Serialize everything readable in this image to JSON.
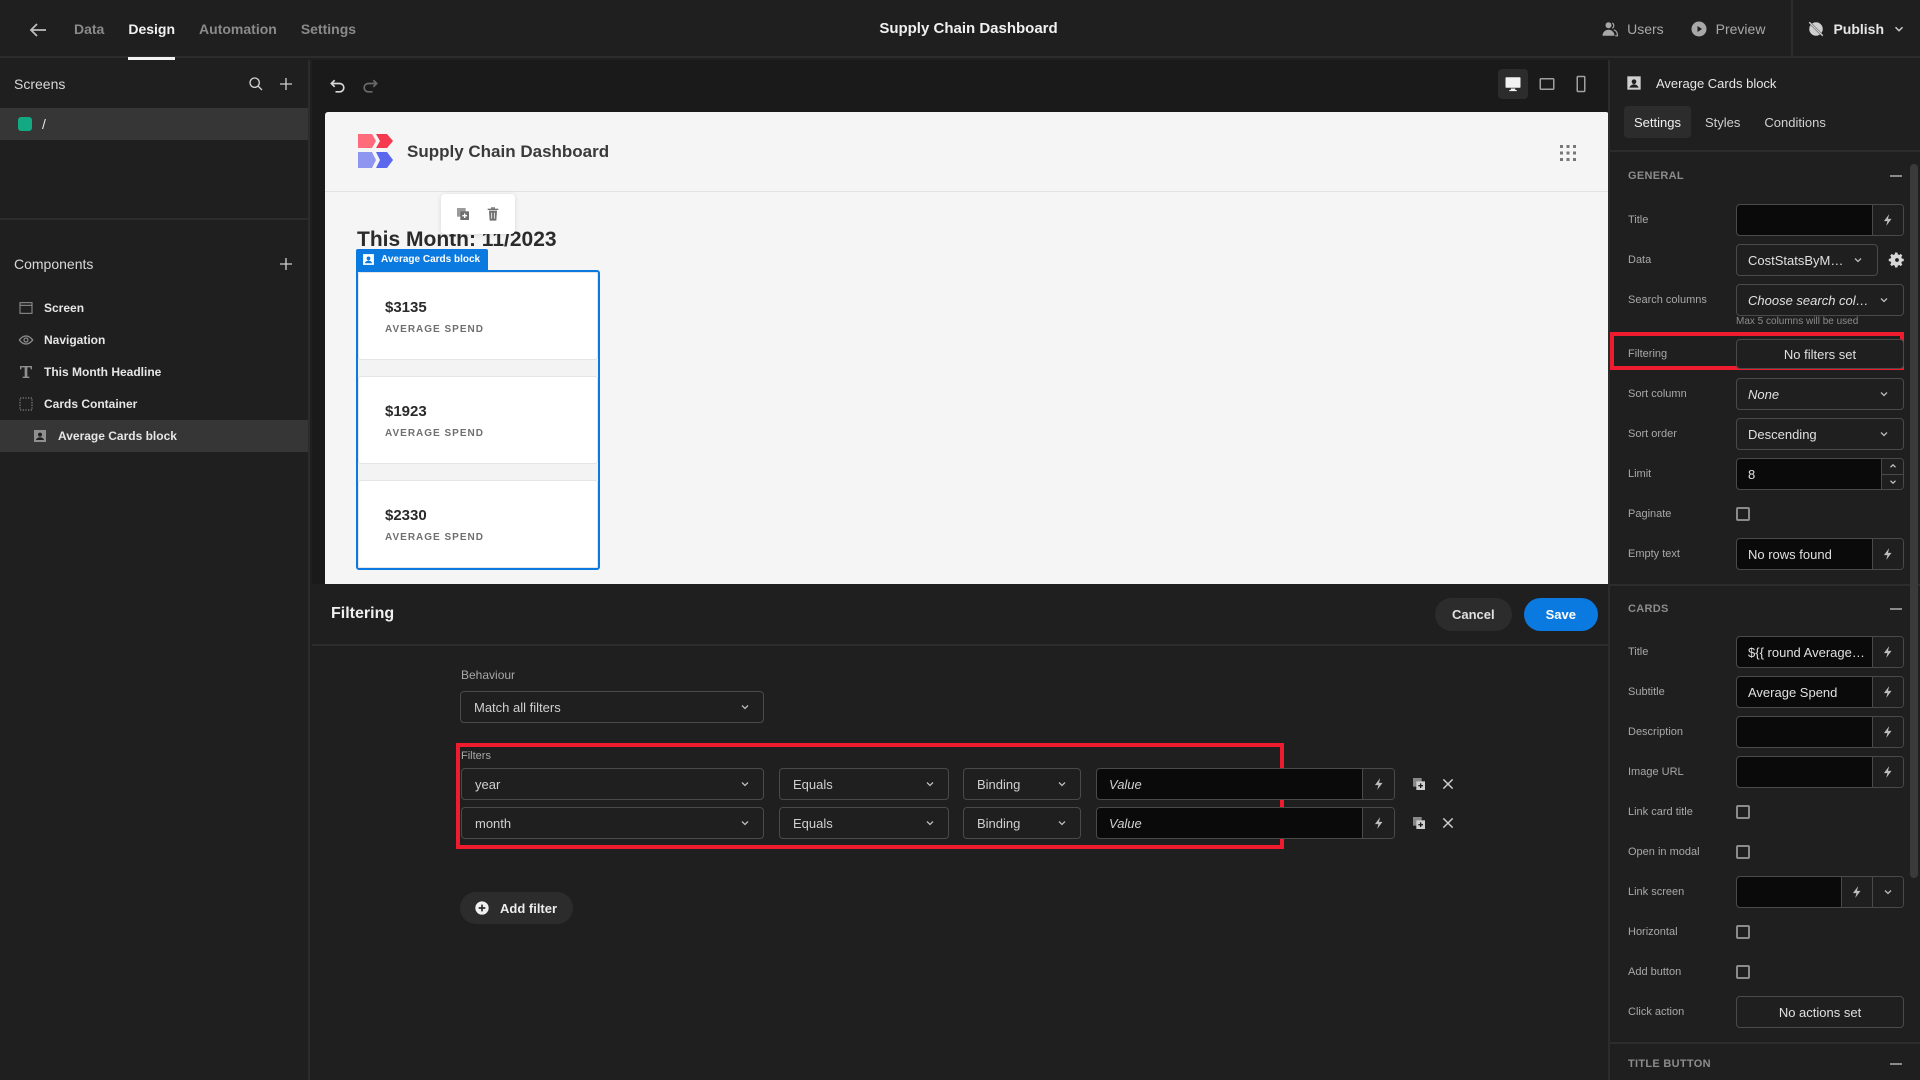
{
  "topbar": {
    "tabs": [
      {
        "label": "Data",
        "active": false
      },
      {
        "label": "Design",
        "active": true
      },
      {
        "label": "Automation",
        "active": false
      },
      {
        "label": "Settings",
        "active": false
      }
    ],
    "app_title": "Supply Chain Dashboard",
    "users_label": "Users",
    "preview_label": "Preview",
    "publish_label": "Publish"
  },
  "left_panel": {
    "screens_title": "Screens",
    "screens": [
      {
        "route": "/",
        "color": "#13a982"
      }
    ],
    "components_title": "Components",
    "components": [
      {
        "label": "Screen",
        "icon": "screen-icon"
      },
      {
        "label": "Navigation",
        "icon": "eye-icon"
      },
      {
        "label": "This Month Headline",
        "icon": "text-icon"
      },
      {
        "label": "Cards Container",
        "icon": "container-icon"
      },
      {
        "label": "Average Cards block",
        "icon": "cards-block-icon",
        "selected": true
      }
    ]
  },
  "preview": {
    "nav_title": "Supply Chain Dashboard",
    "headline": "This Month: 11/2023",
    "block_tag": "Average Cards block",
    "cards": [
      {
        "title": "$3135",
        "subtitle": "AVERAGE SPEND"
      },
      {
        "title": "$1923",
        "subtitle": "AVERAGE SPEND"
      },
      {
        "title": "$2330",
        "subtitle": "AVERAGE SPEND"
      }
    ]
  },
  "filtering": {
    "title": "Filtering",
    "cancel_label": "Cancel",
    "save_label": "Save",
    "behaviour_label": "Behaviour",
    "behaviour_value": "Match all filters",
    "filters_label": "Filters",
    "filters": [
      {
        "field": "year",
        "operator": "Equals",
        "type": "Binding",
        "value_placeholder": "Value"
      },
      {
        "field": "month",
        "operator": "Equals",
        "type": "Binding",
        "value_placeholder": "Value"
      }
    ],
    "add_filter_label": "Add filter",
    "highlight_color": "#ee1c2e"
  },
  "right_panel": {
    "component_name": "Average Cards block",
    "tabs": [
      {
        "label": "Settings",
        "active": true
      },
      {
        "label": "Styles",
        "active": false
      },
      {
        "label": "Conditions",
        "active": false
      }
    ],
    "general": {
      "heading": "GENERAL",
      "title_label": "Title",
      "title_value": "",
      "data_label": "Data",
      "data_value": "CostStatsByM…",
      "search_columns_label": "Search columns",
      "search_columns_placeholder": "Choose search col…",
      "search_columns_hint": "Max 5 columns will be used",
      "filtering_label": "Filtering",
      "filtering_value": "No filters set",
      "sort_column_label": "Sort column",
      "sort_column_value": "None",
      "sort_order_label": "Sort order",
      "sort_order_value": "Descending",
      "limit_label": "Limit",
      "limit_value": "8",
      "paginate_label": "Paginate",
      "paginate_checked": false,
      "empty_text_label": "Empty text",
      "empty_text_value": "No rows found"
    },
    "cards": {
      "heading": "CARDS",
      "title_label": "Title",
      "title_value": "${{ round Average…",
      "subtitle_label": "Subtitle",
      "subtitle_value": "Average Spend",
      "description_label": "Description",
      "description_value": "",
      "image_url_label": "Image URL",
      "image_url_value": "",
      "link_card_title_label": "Link card title",
      "open_in_modal_label": "Open in modal",
      "link_screen_label": "Link screen",
      "horizontal_label": "Horizontal",
      "add_button_label": "Add button",
      "click_action_label": "Click action",
      "click_action_value": "No actions set"
    },
    "title_button_heading": "TITLE BUTTON"
  }
}
